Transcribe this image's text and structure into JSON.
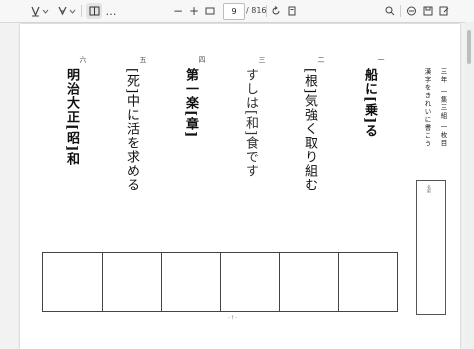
{
  "toolbar": {
    "page_current": "9",
    "page_total": "/ 816",
    "zoom_minus": "−",
    "zoom_plus": "+",
    "more": "…"
  },
  "worksheet": {
    "header": {
      "class_line": "三年 一集三組 一枚目",
      "instruction": "漢字をきれいに書こう"
    },
    "name_label": "名前",
    "questions": [
      {
        "number": "一",
        "text": "船に[乗]る"
      },
      {
        "number": "二",
        "text": "[根]気強く取り組む"
      },
      {
        "number": "三",
        "text": "すしは[和]食です"
      },
      {
        "number": "四",
        "text": "第一楽[章]"
      },
      {
        "number": "五",
        "text": "[死]中に活を求める"
      },
      {
        "number": "六",
        "text": "明治大正[昭]和"
      }
    ],
    "center_mark": "- † -"
  },
  "icons": [
    "draw-icon",
    "chevron-down-icon",
    "highlight-icon",
    "chevron-down-icon",
    "reading-view-icon",
    "more-icon",
    "zoom-out-icon",
    "zoom-in-icon",
    "fit-page-icon",
    "rotate-icon",
    "page-view-icon",
    "search-icon",
    "read-aloud-icon",
    "save-icon",
    "save-as-icon"
  ]
}
